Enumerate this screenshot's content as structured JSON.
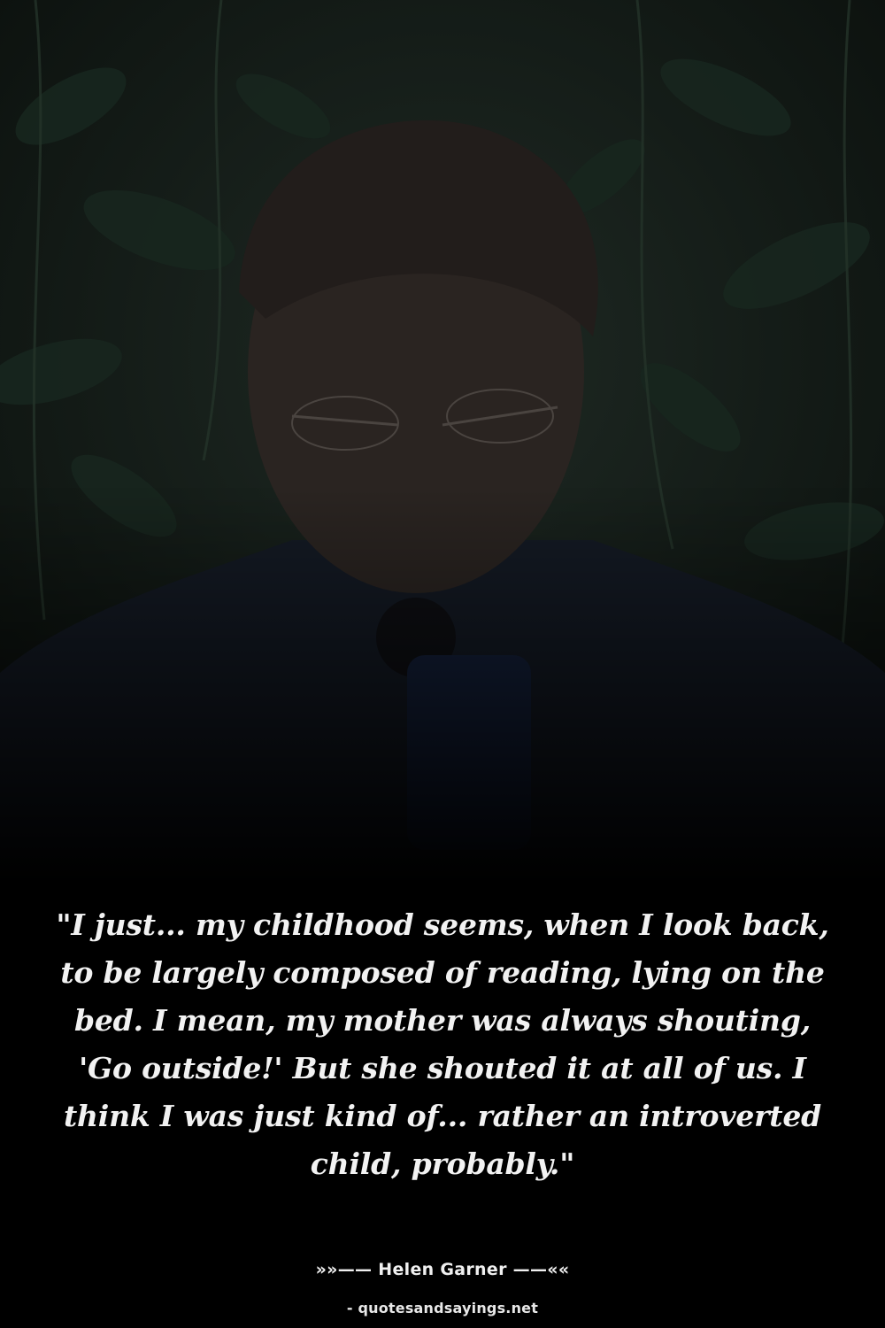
{
  "quote": {
    "text": "\"I just... my childhood seems, when I look back, to be largely composed of reading, lying on the bed. I mean, my mother was always shouting, 'Go outside!' But she shouted it at all of us. I think I was just kind of... rather an introverted child, probably.\""
  },
  "author": {
    "line": "»»—— Helen Garner ——««"
  },
  "source": {
    "line": "- quotesandsayings.net"
  },
  "colors": {
    "background": "#000000",
    "text": "#f2f2f2",
    "foliage": "#1c2a22"
  }
}
